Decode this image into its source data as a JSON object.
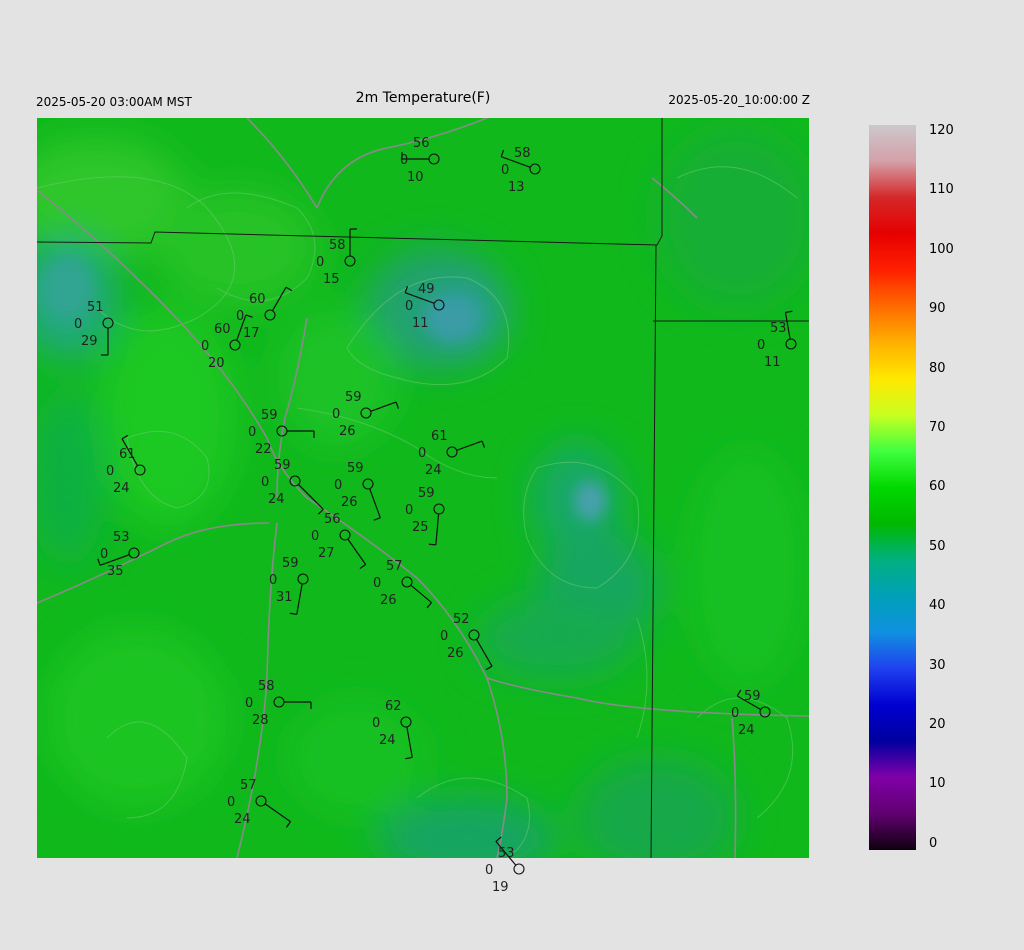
{
  "header": {
    "local_time": "2025-05-20 03:00AM MST",
    "title": "2m Temperature(F)",
    "utc_time": "2025-05-20_10:00:00 Z"
  },
  "colorbar": {
    "labels": [
      "120",
      "110",
      "100",
      "90",
      "80",
      "70",
      "60",
      "50",
      "40",
      "30",
      "20",
      "10",
      "0"
    ],
    "colors": [
      "#ccc8cc",
      "#d4a0a8",
      "#d42828",
      "#e60000",
      "#ff2000",
      "#ff6a00",
      "#ffb000",
      "#ffe800",
      "#c8ff20",
      "#40ff40",
      "#00d800",
      "#00b800",
      "#00b080",
      "#00a0b8",
      "#1090e0",
      "#2040f0",
      "#0000d0",
      "#0000a0",
      "#8000a8",
      "#600070",
      "#100010"
    ]
  },
  "stations": [
    {
      "t": "56",
      "d": "0",
      "v": "10"
    },
    {
      "t": "58",
      "d": "0",
      "v": "13"
    },
    {
      "t": "58",
      "d": "0",
      "v": "15"
    },
    {
      "t": "49",
      "d": "0",
      "v": "11"
    },
    {
      "t": "51",
      "d": "0",
      "v": "29"
    },
    {
      "t": "60",
      "d": "0",
      "v": "17"
    },
    {
      "t": "60",
      "d": "0",
      "v": "20"
    },
    {
      "t": "53",
      "d": "0",
      "v": "11"
    },
    {
      "t": "59",
      "d": "0",
      "v": "26"
    },
    {
      "t": "59",
      "d": "0",
      "v": "22"
    },
    {
      "t": "61",
      "d": "0",
      "v": "24"
    },
    {
      "t": "61",
      "d": "0",
      "v": "24"
    },
    {
      "t": "59",
      "d": "0",
      "v": "24"
    },
    {
      "t": "59",
      "d": "0",
      "v": "26"
    },
    {
      "t": "59",
      "d": "0",
      "v": "25"
    },
    {
      "t": "53",
      "d": "0",
      "v": "35"
    },
    {
      "t": "56",
      "d": "0",
      "v": "27"
    },
    {
      "t": "59",
      "d": "0",
      "v": "31"
    },
    {
      "t": "57",
      "d": "0",
      "v": "26"
    },
    {
      "t": "52",
      "d": "0",
      "v": "26"
    },
    {
      "t": "58",
      "d": "0",
      "v": "28"
    },
    {
      "t": "62",
      "d": "0",
      "v": "24"
    },
    {
      "t": "59",
      "d": "0",
      "v": "24"
    },
    {
      "t": "57",
      "d": "0",
      "v": "24"
    },
    {
      "t": "53",
      "d": "0",
      "v": "19"
    }
  ]
}
